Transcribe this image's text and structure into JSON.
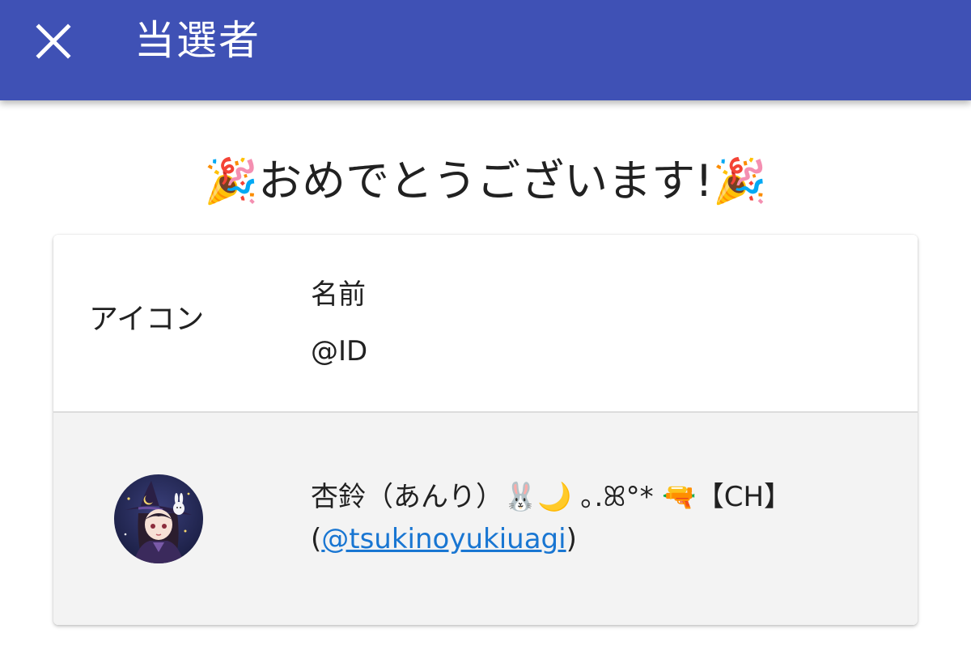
{
  "appbar": {
    "title": "当選者",
    "close_icon": "close-icon",
    "background": "#3f51b5"
  },
  "main": {
    "headline": "🎉おめでとうございます!🎉"
  },
  "table": {
    "headers": {
      "icon": "アイコン",
      "name": "名前",
      "id": "@ID"
    },
    "rows": [
      {
        "avatar": "user-avatar",
        "name": "杏鈴（あんり）🐰🌙 ｡.ꕤ°* 🔫【CH】",
        "id_open": "(",
        "id": "@tsukinoyukiuagi",
        "id_close": ")"
      }
    ]
  },
  "colors": {
    "link": "#1976d2",
    "row_bg": "#f3f3f3"
  }
}
